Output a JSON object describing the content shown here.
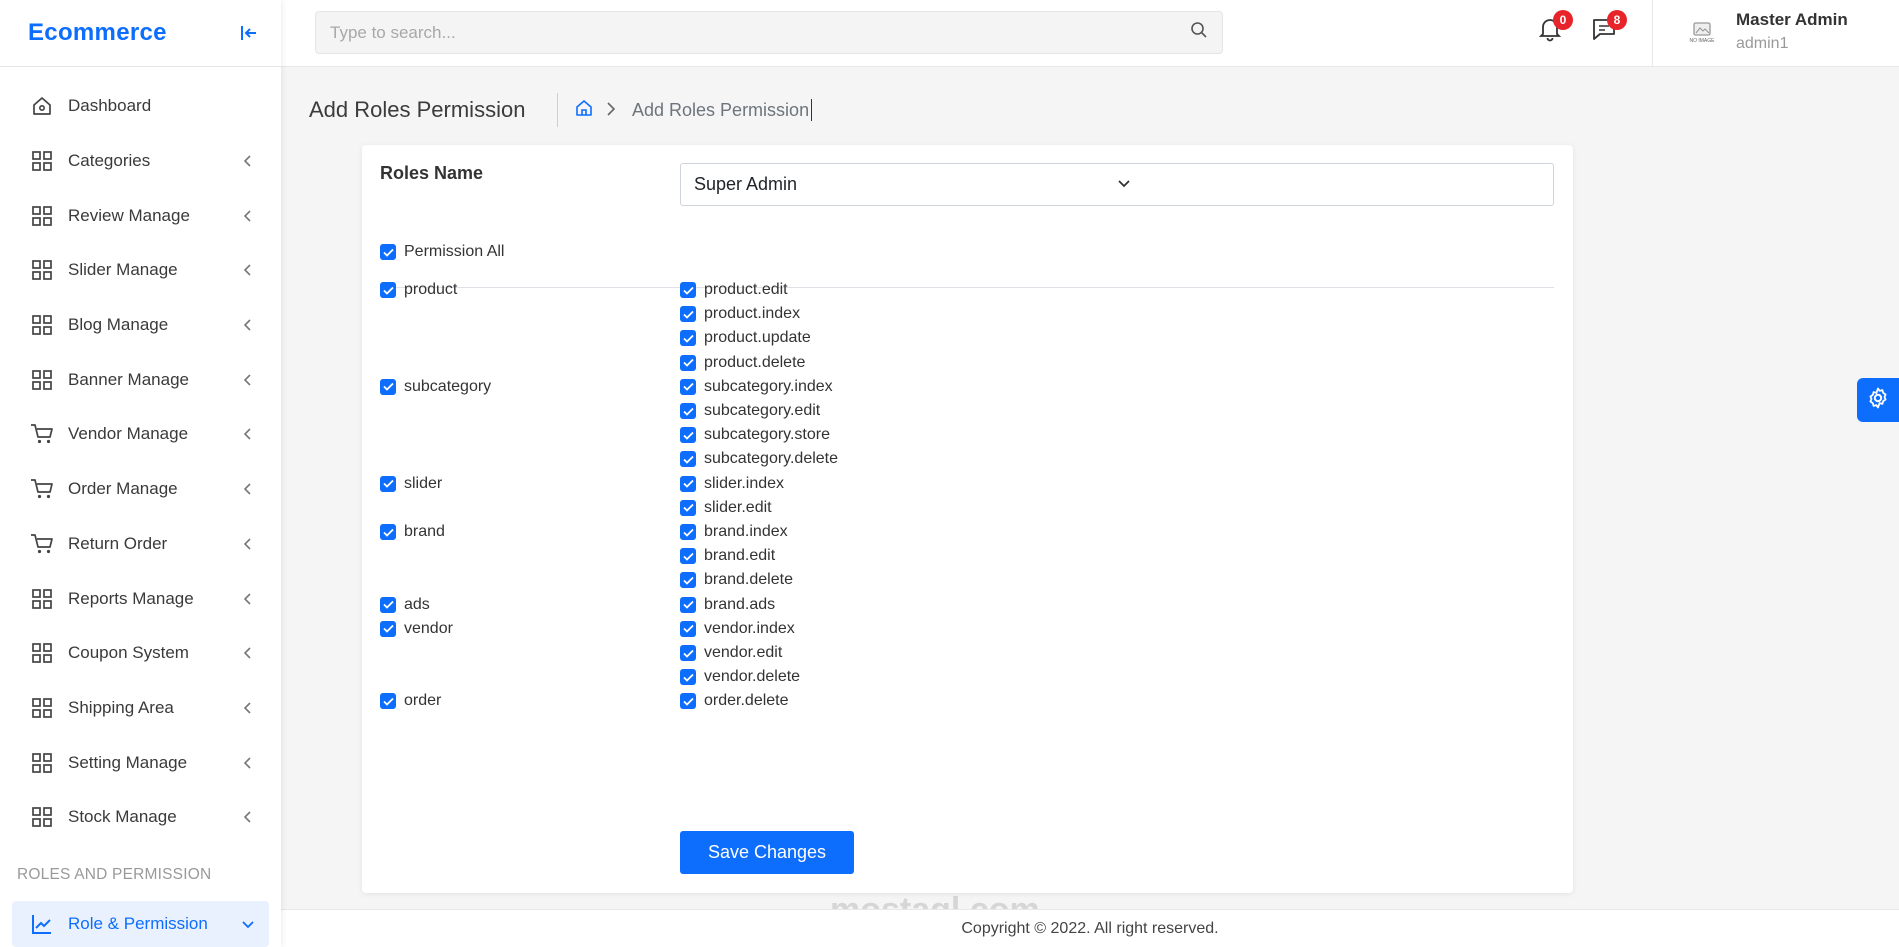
{
  "app": {
    "brand": "Ecommerce"
  },
  "sidebar": {
    "items": [
      {
        "label": "Dashboard",
        "icon": "home-icon",
        "chevron": false
      },
      {
        "label": "Categories",
        "icon": "grid-icon",
        "chevron": true
      },
      {
        "label": "Review Manage",
        "icon": "grid-icon",
        "chevron": true
      },
      {
        "label": "Slider Manage",
        "icon": "grid-icon",
        "chevron": true
      },
      {
        "label": "Blog Manage",
        "icon": "grid-icon",
        "chevron": true
      },
      {
        "label": "Banner Manage",
        "icon": "grid-icon",
        "chevron": true
      },
      {
        "label": "Vendor Manage",
        "icon": "cart-icon",
        "chevron": true
      },
      {
        "label": "Order Manage",
        "icon": "cart-icon",
        "chevron": true
      },
      {
        "label": "Return Order",
        "icon": "cart-icon",
        "chevron": true
      },
      {
        "label": "Reports Manage",
        "icon": "grid-icon",
        "chevron": true
      },
      {
        "label": "Coupon System",
        "icon": "grid-icon",
        "chevron": true
      },
      {
        "label": "Shipping Area",
        "icon": "grid-icon",
        "chevron": true
      },
      {
        "label": "Setting Manage",
        "icon": "grid-icon",
        "chevron": true
      },
      {
        "label": "Stock Manage",
        "icon": "grid-icon",
        "chevron": true
      }
    ],
    "section_title": "ROLES AND PERMISSION",
    "active_item": {
      "label": "Role & Permission",
      "icon": "chart-line-icon"
    }
  },
  "topbar": {
    "search_placeholder": "Type to search...",
    "notifications_count": "0",
    "messages_count": "8",
    "avatar_text": "NO IMAGE",
    "user_name": "Master Admin",
    "user_role": "admin1"
  },
  "page": {
    "title": "Add Roles Permission",
    "breadcrumb_current": "Add Roles Permission"
  },
  "form": {
    "roles_label": "Roles Name",
    "roles_selected": "Super Admin",
    "permission_all_label": "Permission All",
    "groups": [
      {
        "name": "product",
        "permissions": [
          "product.edit",
          "product.index",
          "product.update",
          "product.delete"
        ]
      },
      {
        "name": "subcategory",
        "permissions": [
          "subcategory.index",
          "subcategory.edit",
          "subcategory.store",
          "subcategory.delete"
        ]
      },
      {
        "name": "slider",
        "permissions": [
          "slider.index",
          "slider.edit"
        ]
      },
      {
        "name": "brand",
        "permissions": [
          "brand.index",
          "brand.edit",
          "brand.delete"
        ]
      },
      {
        "name": "ads",
        "permissions": [
          "brand.ads"
        ]
      },
      {
        "name": "vendor",
        "permissions": [
          "vendor.index",
          "vendor.edit",
          "vendor.delete"
        ]
      },
      {
        "name": "order",
        "permissions": [
          "order.delete"
        ]
      }
    ],
    "save_label": "Save Changes"
  },
  "footer": {
    "copyright": "Copyright © 2022. All right reserved."
  },
  "watermark": {
    "text": "mostaql.com"
  },
  "colors": {
    "accent": "#0d6efd",
    "badge": "#e8242b",
    "background": "#f5f5f5"
  }
}
